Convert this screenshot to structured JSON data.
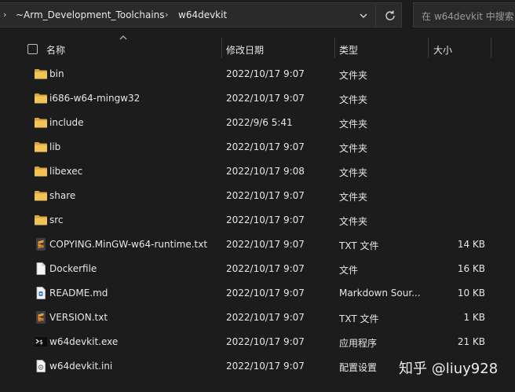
{
  "address_bar": {
    "crumbs": [
      "~Arm_Development_Toolchains",
      "w64devkit"
    ],
    "search_placeholder": "在 w64devkit 中搜索"
  },
  "columns": {
    "name": "名称",
    "date": "修改日期",
    "type": "类型",
    "size": "大小"
  },
  "files": [
    {
      "name": "bin",
      "date": "2022/10/17 9:07",
      "type": "文件夹",
      "size": "",
      "icon": "folder-icon"
    },
    {
      "name": "i686-w64-mingw32",
      "date": "2022/10/17 9:07",
      "type": "文件夹",
      "size": "",
      "icon": "folder-icon"
    },
    {
      "name": "include",
      "date": "2022/9/6 5:41",
      "type": "文件夹",
      "size": "",
      "icon": "folder-icon"
    },
    {
      "name": "lib",
      "date": "2022/10/17 9:07",
      "type": "文件夹",
      "size": "",
      "icon": "folder-icon"
    },
    {
      "name": "libexec",
      "date": "2022/10/17 9:08",
      "type": "文件夹",
      "size": "",
      "icon": "folder-icon"
    },
    {
      "name": "share",
      "date": "2022/10/17 9:07",
      "type": "文件夹",
      "size": "",
      "icon": "folder-icon"
    },
    {
      "name": "src",
      "date": "2022/10/17 9:07",
      "type": "文件夹",
      "size": "",
      "icon": "folder-icon"
    },
    {
      "name": "COPYING.MinGW-w64-runtime.txt",
      "date": "2022/10/17 9:07",
      "type": "TXT 文件",
      "size": "14 KB",
      "icon": "sublime-text-icon"
    },
    {
      "name": "Dockerfile",
      "date": "2022/10/17 9:07",
      "type": "文件",
      "size": "16 KB",
      "icon": "blank-file-icon"
    },
    {
      "name": "README.md",
      "date": "2022/10/17 9:07",
      "type": "Markdown Sour...",
      "size": "10 KB",
      "icon": "markdown-file-icon"
    },
    {
      "name": "VERSION.txt",
      "date": "2022/10/17 9:07",
      "type": "TXT 文件",
      "size": "1 KB",
      "icon": "sublime-text-icon"
    },
    {
      "name": "w64devkit.exe",
      "date": "2022/10/17 9:07",
      "type": "应用程序",
      "size": "21 KB",
      "icon": "terminal-exe-icon"
    },
    {
      "name": "w64devkit.ini",
      "date": "2022/10/17 9:07",
      "type": "配置设置",
      "size": "",
      "icon": "ini-settings-icon"
    }
  ],
  "watermark": "知乎 @liuy928",
  "colors": {
    "background": "#1c1c1c",
    "folder": "#e8b84a",
    "sublime": "#f39c26",
    "text": "#e6e6e6"
  }
}
